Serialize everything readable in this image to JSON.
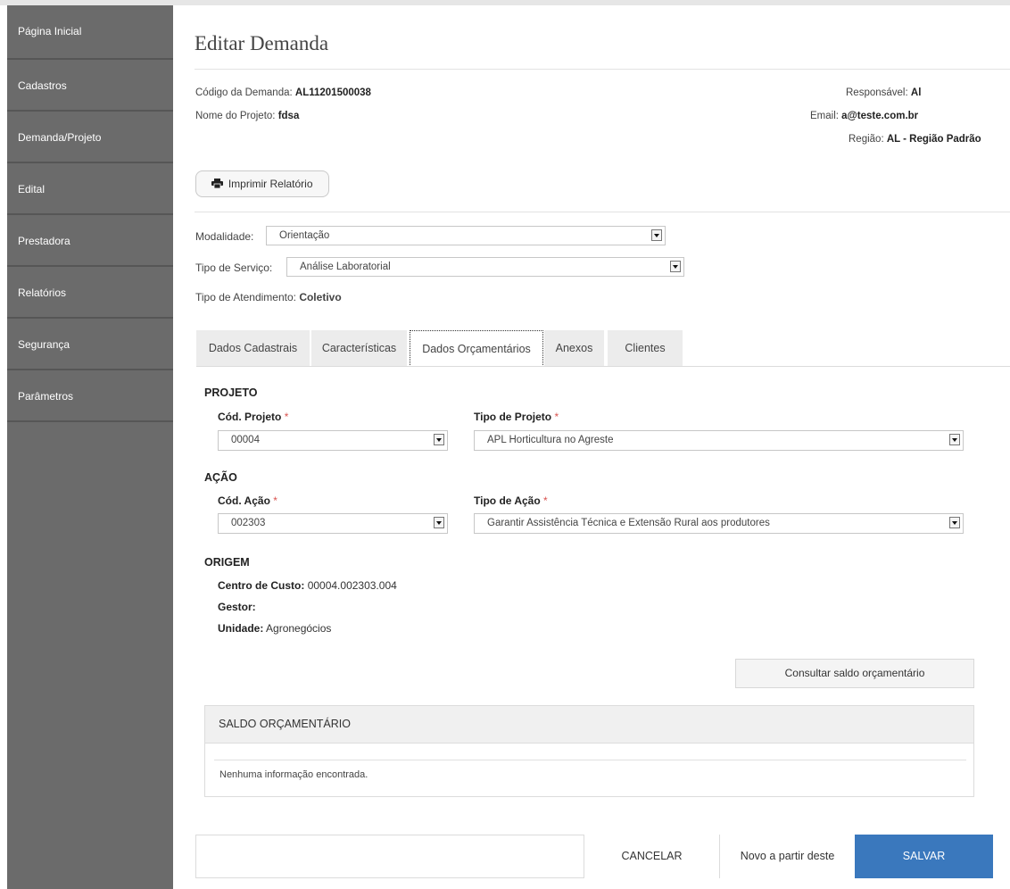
{
  "sidebar": {
    "items": [
      {
        "label": "Página Inicial"
      },
      {
        "label": "Cadastros"
      },
      {
        "label": "Demanda/Projeto"
      },
      {
        "label": "Edital"
      },
      {
        "label": "Prestadora"
      },
      {
        "label": "Relatórios"
      },
      {
        "label": "Segurança"
      },
      {
        "label": "Parâmetros"
      }
    ]
  },
  "page": {
    "title": "Editar Demanda"
  },
  "header_info": {
    "codigo_label": "Código da Demanda:",
    "codigo_value": "AL11201500038",
    "projeto_label": "Nome do Projeto:",
    "projeto_value": "fdsa",
    "responsavel_label": "Responsável:",
    "responsavel_value": "Al",
    "email_label": "Email:",
    "email_value": "a@teste.com.br",
    "regiao_label": "Região:",
    "regiao_value": "AL - Região Padrão"
  },
  "print_button": {
    "label": "Imprimir Relatório",
    "icon": "printer-icon"
  },
  "form": {
    "modalidade_label": "Modalidade:",
    "modalidade_value": "Orientação",
    "tipo_servico_label": "Tipo de Serviço:",
    "tipo_servico_value": "Análise Laboratorial",
    "tipo_atendimento_label": "Tipo de Atendimento:",
    "tipo_atendimento_value": "Coletivo"
  },
  "tabs": [
    {
      "label": "Dados Cadastrais"
    },
    {
      "label": "Características"
    },
    {
      "label": "Dados Orçamentários",
      "active": true
    },
    {
      "label": "Anexos"
    },
    {
      "label": "Clientes"
    }
  ],
  "projeto": {
    "section_title": "PROJETO",
    "cod_label": "Cód. Projeto",
    "cod_value": "00004",
    "tipo_label": "Tipo de Projeto",
    "tipo_value": "APL Horticultura no Agreste"
  },
  "acao": {
    "section_title": "AÇÃO",
    "cod_label": "Cód. Ação",
    "cod_value": "002303",
    "tipo_label": "Tipo de Ação",
    "tipo_value": "Garantir Assistência Técnica e Extensão Rural aos produtores"
  },
  "required_mark": "*",
  "origem": {
    "section_title": "ORIGEM",
    "centro_label": "Centro de Custo:",
    "centro_value": "00004.002303.004",
    "gestor_label": "Gestor:",
    "gestor_value": "",
    "unidade_label": "Unidade:",
    "unidade_value": "Agronegócios"
  },
  "consultar_button": {
    "label": "Consultar saldo orçamentário"
  },
  "saldo_panel": {
    "title": "SALDO ORÇAMENTÁRIO",
    "empty_message": "Nenhuma informação encontrada."
  },
  "footer": {
    "cancel_label": "CANCELAR",
    "novo_label": "Novo a partir deste",
    "save_label": "SALVAR"
  },
  "colors": {
    "sidebar_bg": "#6b6b6b",
    "save_button": "#3a78bd",
    "required": "#d9534f"
  }
}
